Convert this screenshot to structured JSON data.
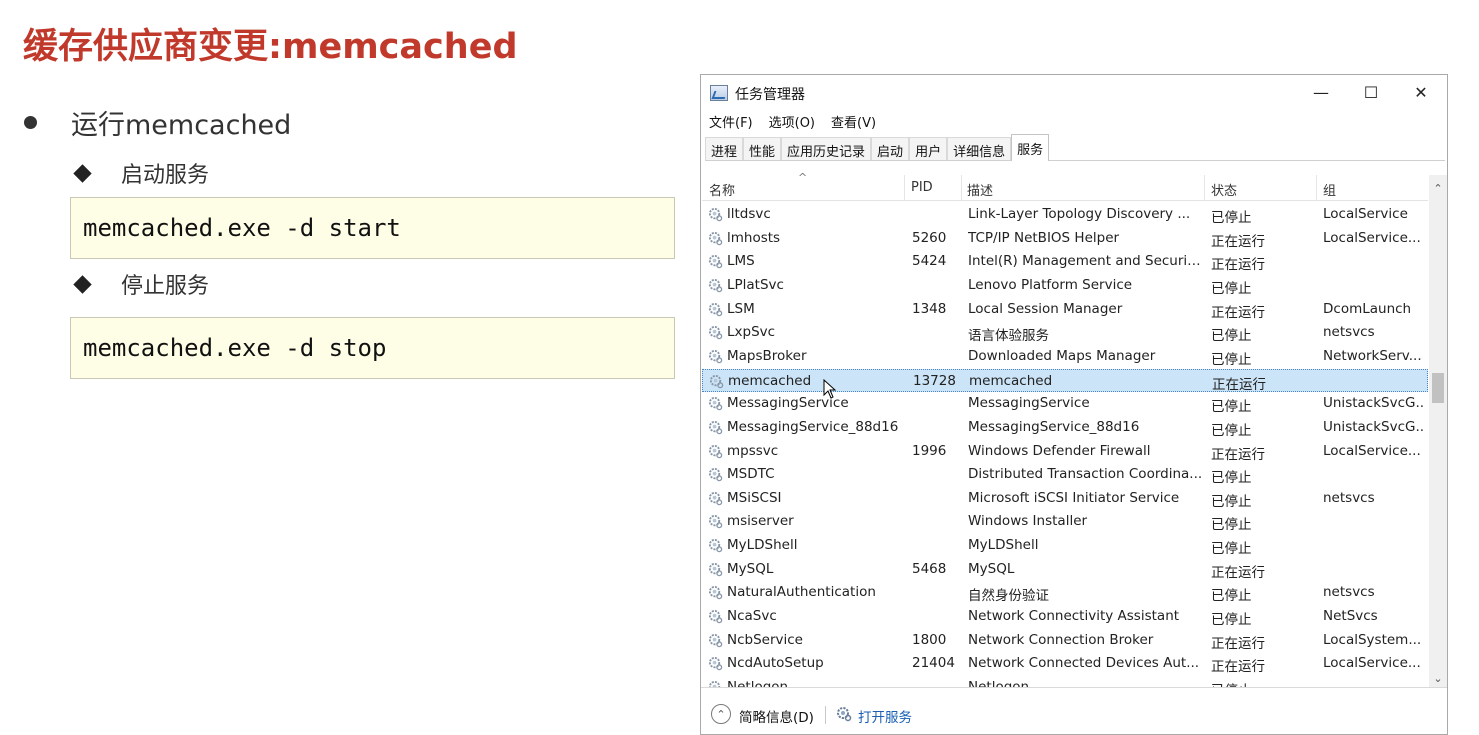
{
  "slide": {
    "title": "缓存供应商变更:memcached",
    "bullet": "运行memcached",
    "sub1": "启动服务",
    "code1": "memcached.exe -d start",
    "sub2": "停止服务",
    "code2": "memcached.exe -d stop",
    "title_color": "#c0392b",
    "code_bg": "#fefde6"
  },
  "window": {
    "title": "任务管理器",
    "controls": {
      "minimize": "—",
      "maximize": "☐",
      "close": "✕"
    },
    "menu": [
      "文件(F)",
      "选项(O)",
      "查看(V)"
    ],
    "tabs": [
      "进程",
      "性能",
      "应用历史记录",
      "启动",
      "用户",
      "详细信息",
      "服务"
    ],
    "active_tab": "服务",
    "columns": {
      "name": "名称",
      "pid": "PID",
      "desc": "描述",
      "status": "状态",
      "group": "组"
    },
    "rows": [
      {
        "name": "lltdsvc",
        "pid": "",
        "desc": "Link-Layer Topology Discovery ...",
        "status": "已停止",
        "group": "LocalService"
      },
      {
        "name": "lmhosts",
        "pid": "5260",
        "desc": "TCP/IP NetBIOS Helper",
        "status": "正在运行",
        "group": "LocalService..."
      },
      {
        "name": "LMS",
        "pid": "5424",
        "desc": "Intel(R) Management and Securit...",
        "status": "正在运行",
        "group": ""
      },
      {
        "name": "LPlatSvc",
        "pid": "",
        "desc": "Lenovo Platform Service",
        "status": "已停止",
        "group": ""
      },
      {
        "name": "LSM",
        "pid": "1348",
        "desc": "Local Session Manager",
        "status": "正在运行",
        "group": "DcomLaunch"
      },
      {
        "name": "LxpSvc",
        "pid": "",
        "desc": "语言体验服务",
        "status": "已停止",
        "group": "netsvcs"
      },
      {
        "name": "MapsBroker",
        "pid": "",
        "desc": "Downloaded Maps Manager",
        "status": "已停止",
        "group": "NetworkServ..."
      },
      {
        "name": "memcached",
        "pid": "13728",
        "desc": "memcached",
        "status": "正在运行",
        "group": ""
      },
      {
        "name": "MessagingService",
        "pid": "",
        "desc": "MessagingService",
        "status": "已停止",
        "group": "UnistackSvcG..."
      },
      {
        "name": "MessagingService_88d16",
        "pid": "",
        "desc": "MessagingService_88d16",
        "status": "已停止",
        "group": "UnistackSvcG..."
      },
      {
        "name": "mpssvc",
        "pid": "1996",
        "desc": "Windows Defender Firewall",
        "status": "正在运行",
        "group": "LocalService..."
      },
      {
        "name": "MSDTC",
        "pid": "",
        "desc": "Distributed Transaction Coordina...",
        "status": "已停止",
        "group": ""
      },
      {
        "name": "MSiSCSI",
        "pid": "",
        "desc": "Microsoft iSCSI Initiator Service",
        "status": "已停止",
        "group": "netsvcs"
      },
      {
        "name": "msiserver",
        "pid": "",
        "desc": "Windows Installer",
        "status": "已停止",
        "group": ""
      },
      {
        "name": "MyLDShell",
        "pid": "",
        "desc": "MyLDShell",
        "status": "已停止",
        "group": ""
      },
      {
        "name": "MySQL",
        "pid": "5468",
        "desc": "MySQL",
        "status": "正在运行",
        "group": ""
      },
      {
        "name": "NaturalAuthentication",
        "pid": "",
        "desc": "自然身份验证",
        "status": "已停止",
        "group": "netsvcs"
      },
      {
        "name": "NcaSvc",
        "pid": "",
        "desc": "Network Connectivity Assistant",
        "status": "已停止",
        "group": "NetSvcs"
      },
      {
        "name": "NcbService",
        "pid": "1800",
        "desc": "Network Connection Broker",
        "status": "正在运行",
        "group": "LocalSystem..."
      },
      {
        "name": "NcdAutoSetup",
        "pid": "21404",
        "desc": "Network Connected Devices Aut...",
        "status": "正在运行",
        "group": "LocalService..."
      },
      {
        "name": "Netlogon",
        "pid": "",
        "desc": "Netlogon",
        "status": "已停止",
        "group": ""
      }
    ],
    "selected_row": "memcached",
    "footer": {
      "brief": "简略信息(D)",
      "open_services": "打开服务"
    },
    "selection_color": "#cce4f7",
    "link_color": "#1a5fb4"
  }
}
